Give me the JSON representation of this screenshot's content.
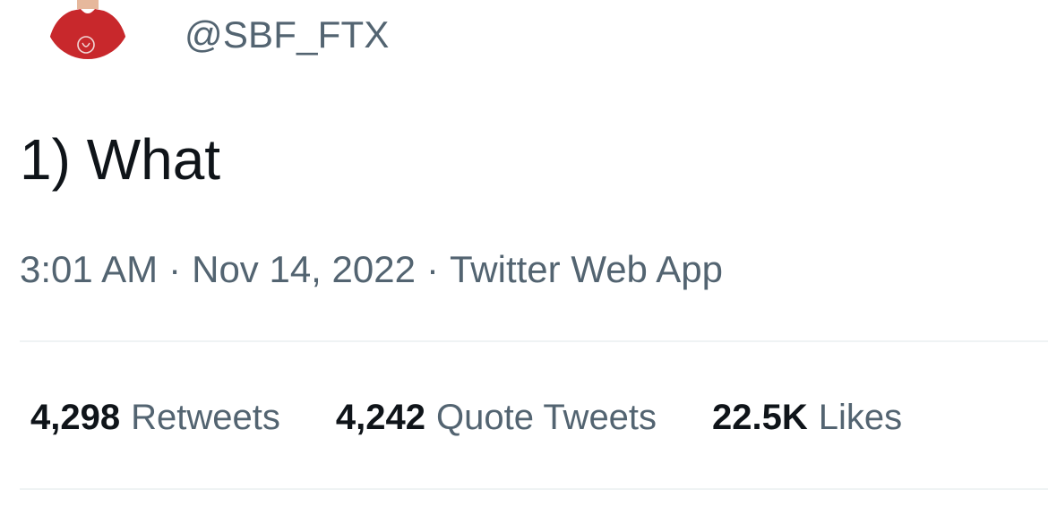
{
  "tweet": {
    "handle": "@SBF_FTX",
    "text": "1) What",
    "time": "3:01 AM",
    "date": "Nov 14, 2022",
    "source": "Twitter Web App",
    "separator": "·"
  },
  "stats": [
    {
      "value": "4,298",
      "label": "Retweets"
    },
    {
      "value": "4,242",
      "label": "Quote Tweets"
    },
    {
      "value": "22.5K",
      "label": "Likes"
    }
  ],
  "colors": {
    "text_primary": "#0f1419",
    "text_secondary": "#536471",
    "divider": "#eff3f4",
    "avatar_shirt": "#c8282c"
  },
  "icons": {
    "avatar": "profile-avatar"
  }
}
